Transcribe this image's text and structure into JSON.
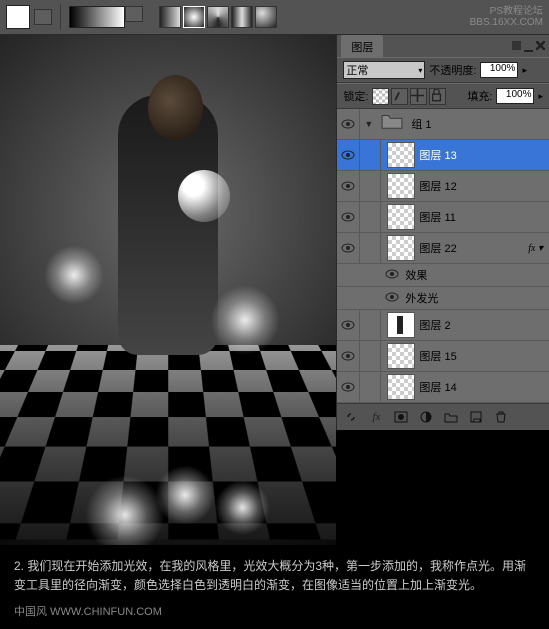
{
  "watermark": {
    "line1": "PS教程论坛",
    "line2": "BBS.16XX.COM"
  },
  "toolbar": {
    "gradient_presets": [
      "black-white",
      "checker"
    ]
  },
  "panel": {
    "tab": "图层",
    "blend_label": "正常",
    "opacity_label": "不透明度:",
    "opacity_value": "100%",
    "lock_label": "锁定:",
    "fill_label": "填充:",
    "fill_value": "100%",
    "group_name": "组 1",
    "layers": [
      {
        "name": "图层 13",
        "sel": true
      },
      {
        "name": "图层 12"
      },
      {
        "name": "图层 11"
      },
      {
        "name": "图层 22",
        "fx": true
      },
      {
        "name": "图层 2",
        "thumb": "fig"
      },
      {
        "name": "图层 15"
      },
      {
        "name": "图层 14"
      }
    ],
    "fx_label": "效果",
    "fx_item": "外发光"
  },
  "caption": "2. 我们现在开始添加光效，在我的风格里，光效大概分为3种，第一步添加的，我称作点光。用渐变工具里的径向渐变，颜色选择白色到透明白的渐变，在图像适当的位置上加上渐变光。",
  "credit": "中国风  WWW.CHINFUN.COM"
}
